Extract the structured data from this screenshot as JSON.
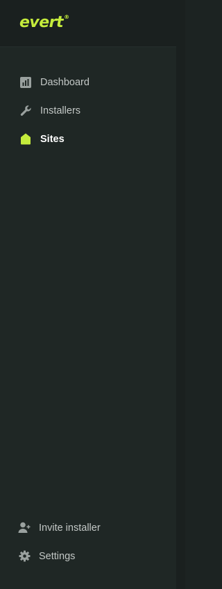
{
  "brand": {
    "name": "evert",
    "mark": "®",
    "accent": "#c5ec3c"
  },
  "nav": {
    "items": [
      {
        "label": "Dashboard",
        "icon": "bar-chart-icon",
        "active": false
      },
      {
        "label": "Installers",
        "icon": "wrench-icon",
        "active": false
      },
      {
        "label": "Sites",
        "icon": "house-icon",
        "active": true
      }
    ]
  },
  "footer": {
    "items": [
      {
        "label": "Invite installer",
        "icon": "add-user-icon"
      },
      {
        "label": "Settings",
        "icon": "gear-icon"
      }
    ]
  }
}
